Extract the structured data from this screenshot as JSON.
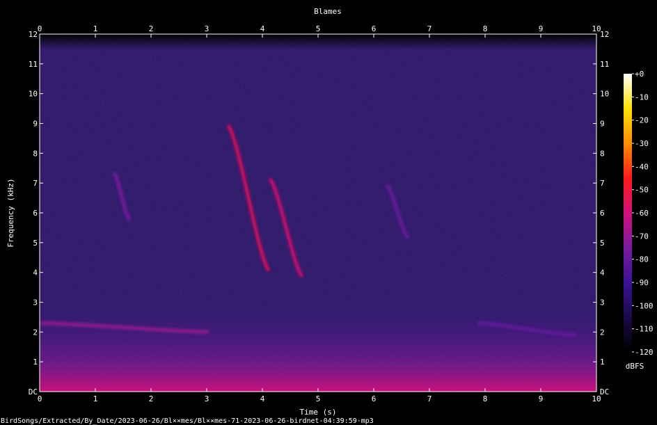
{
  "chart_data": {
    "type": "heatmap",
    "title": "Blames",
    "xlabel": "Time (s)",
    "ylabel": "Frequency (kHz)",
    "xlim": [
      0,
      10
    ],
    "ylim": [
      0,
      12
    ],
    "x_ticks": [
      "0",
      "1",
      "2",
      "3",
      "4",
      "5",
      "6",
      "7",
      "8",
      "9",
      "10"
    ],
    "y_ticks": [
      "DC",
      "1",
      "2",
      "3",
      "4",
      "5",
      "6",
      "7",
      "8",
      "9",
      "10",
      "11",
      "12"
    ],
    "colorbar": {
      "label": "dBFS",
      "ticks": [
        "+0",
        "-10",
        "-20",
        "-30",
        "-40",
        "-50",
        "-60",
        "-70",
        "-80",
        "-90",
        "-100",
        "-110",
        "-120"
      ],
      "range": [
        -120,
        0
      ],
      "colors": [
        "#000000",
        "#1a0a4a",
        "#3a1296",
        "#7a1aa0",
        "#d0107a",
        "#ff1a1a",
        "#ff8c00",
        "#ffe000",
        "#ffffff"
      ]
    },
    "series": [
      {
        "t_start": 0.05,
        "t_end": 3.0,
        "f_start": 2.3,
        "f_end": 2.0,
        "level": -70
      },
      {
        "t_start": 1.35,
        "t_end": 1.6,
        "f_start": 7.3,
        "f_end": 5.8,
        "level": -75
      },
      {
        "t_start": 3.4,
        "t_end": 4.1,
        "f_start": 8.9,
        "f_end": 4.1,
        "level": -55
      },
      {
        "t_start": 4.15,
        "t_end": 4.7,
        "f_start": 7.1,
        "f_end": 3.9,
        "level": -58
      },
      {
        "t_start": 6.25,
        "t_end": 6.6,
        "f_start": 6.9,
        "f_end": 5.2,
        "level": -78
      },
      {
        "t_start": 7.9,
        "t_end": 9.6,
        "f_start": 2.3,
        "f_end": 1.9,
        "level": -80
      }
    ],
    "background_level": -95,
    "low_freq_noise_level": -70
  },
  "footer": {
    "file_path": "BirdSongs/Extracted/By_Date/2023-06-26/Bl××mes/Bl××mes-71-2023-06-26-birdnet-04:39:59·mp3"
  }
}
